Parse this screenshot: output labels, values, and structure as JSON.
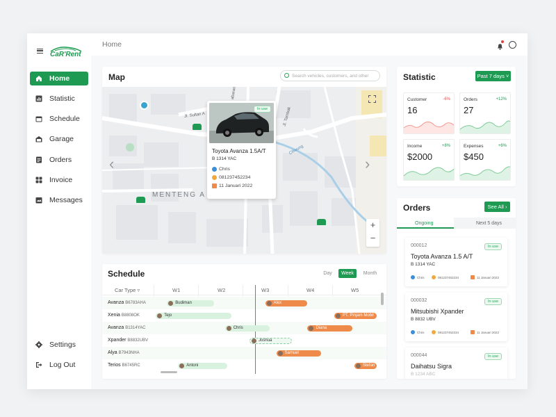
{
  "brand": {
    "logo_text": "CaR'Rent"
  },
  "sidebar": {
    "items": [
      {
        "label": "Home",
        "icon": "home-icon",
        "active": true
      },
      {
        "label": "Statistic",
        "icon": "bar-chart-icon"
      },
      {
        "label": "Schedule",
        "icon": "calendar-icon"
      },
      {
        "label": "Garage",
        "icon": "garage-icon"
      },
      {
        "label": "Orders",
        "icon": "clipboard-icon"
      },
      {
        "label": "Invoice",
        "icon": "invoice-icon"
      },
      {
        "label": "Messages",
        "icon": "messages-icon"
      }
    ],
    "bottom": [
      {
        "label": "Settings",
        "icon": "gear-icon"
      },
      {
        "label": "Log Out",
        "icon": "logout-icon"
      }
    ]
  },
  "topbar": {
    "breadcrumb": "Home"
  },
  "map": {
    "title": "Map",
    "search_placeholder": "Search vehicles, customers, and other",
    "district_label": "MENTENG A",
    "streets": [
      "Jl. Sultan A",
      "Jl. Tambak",
      "Ciliwung",
      "abaran"
    ],
    "popup": {
      "status": "In use",
      "car_name": "Toyota Avanza 1.5A/T",
      "plate": "B 1314 YAC",
      "customer": "Chris",
      "phone": "081237452234",
      "date": "11 Januari 2022"
    }
  },
  "schedule": {
    "title": "Schedule",
    "views": [
      "Day",
      "Week",
      "Month"
    ],
    "active_view": "Week",
    "car_type_header": "Car Type",
    "weeks": [
      "W1",
      "W2",
      "W3",
      "W4",
      "W5"
    ],
    "rows": [
      {
        "car": "Avanza",
        "plate": "B6783AHA",
        "bookings": [
          {
            "name": "Budiman",
            "style": "green",
            "start": 0.3,
            "end": 1.35
          },
          {
            "name": "Alex",
            "style": "orange",
            "start": 2.5,
            "end": 3.45
          }
        ]
      },
      {
        "car": "Xenia",
        "plate": "B8808OK",
        "bookings": [
          {
            "name": "Tejo",
            "style": "green",
            "start": 0.05,
            "end": 1.75
          },
          {
            "name": "PT. Pinjam Mobil",
            "style": "orange",
            "start": 4.05,
            "end": 5.0
          }
        ]
      },
      {
        "car": "Avanza",
        "plate": "B1314YAC",
        "bookings": [
          {
            "name": "Chris",
            "style": "green",
            "start": 1.6,
            "end": 2.6
          },
          {
            "name": "Diana",
            "style": "orange",
            "start": 3.45,
            "end": 4.45
          }
        ]
      },
      {
        "car": "Xpander",
        "plate": "B8832UBV",
        "bookings": [
          {
            "name": "Joshua",
            "style": "dashed",
            "start": 2.15,
            "end": 3.1
          }
        ]
      },
      {
        "car": "Alya",
        "plate": "B7943NHA",
        "bookings": [
          {
            "name": "Samuel",
            "style": "orange",
            "start": 2.75,
            "end": 3.75
          }
        ]
      },
      {
        "car": "Terios",
        "plate": "B6745RC",
        "bookings": [
          {
            "name": "Antoni",
            "style": "green",
            "start": 0.55,
            "end": 1.65
          },
          {
            "name": "Stefan",
            "style": "orange",
            "start": 4.5,
            "end": 5.0
          }
        ]
      }
    ]
  },
  "statistic": {
    "title": "Statistic",
    "range_button": "Past 7 days",
    "tiles": [
      {
        "label": "Customer",
        "change": "-6%",
        "trend": "down",
        "value": "16"
      },
      {
        "label": "Orders",
        "change": "+12%",
        "trend": "up",
        "value": "27"
      },
      {
        "label": "Income",
        "change": "+8%",
        "trend": "up",
        "value": "$2000"
      },
      {
        "label": "Expenses",
        "change": "+6%",
        "trend": "up",
        "value": "$450"
      }
    ]
  },
  "orders": {
    "title": "Orders",
    "see_all": "See All",
    "tabs": [
      "Ongoing",
      "Next 5 days"
    ],
    "active_tab": "Ongoing",
    "items": [
      {
        "id": "000012",
        "status": "In use",
        "name": "Toyota Avanza 1.5 A/T",
        "plate": "B 1314 YAC",
        "customer": "Chris",
        "phone": "081237452234",
        "date": "11 Januari 2022"
      },
      {
        "id": "000032",
        "status": "In use",
        "name": "Mitsubishi Xpander",
        "plate": "B 8832 UBV",
        "customer": "Chris",
        "phone": "081237452234",
        "date": "11 Januari 2022"
      },
      {
        "id": "000044",
        "status": "In use",
        "name": "Daihatsu Sigra",
        "plate": "B 1234 ABC"
      }
    ]
  },
  "colors": {
    "primary": "#1e9a53",
    "accent_orange": "#ee8a4a",
    "danger": "#e05050"
  }
}
